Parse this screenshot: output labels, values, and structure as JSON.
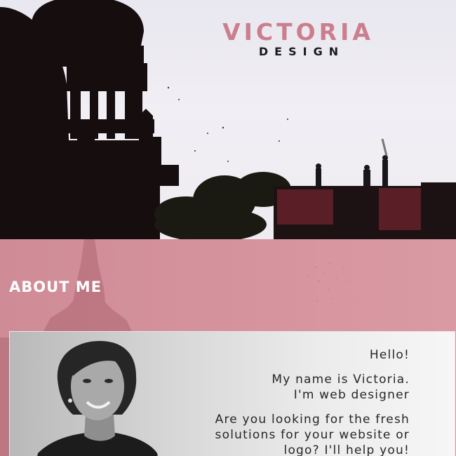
{
  "brand": {
    "name": "VICTORIA",
    "subtitle": "DESIGN",
    "name_color": "#cb7f8e"
  },
  "hero": {
    "image": "silhouette-of-domed-palace-and-rooftop-figures-flying-kites"
  },
  "about": {
    "title": "ABOUT ME",
    "background_color": "#d5919c",
    "greeting": "Hello!",
    "intro_line1": "My name is Victoria.",
    "intro_line2": "I'm web designer",
    "pitch_line1": "Are you looking for the fresh",
    "pitch_line2": "solutions for your website or",
    "pitch_line3": "logo? I'll help you!"
  }
}
